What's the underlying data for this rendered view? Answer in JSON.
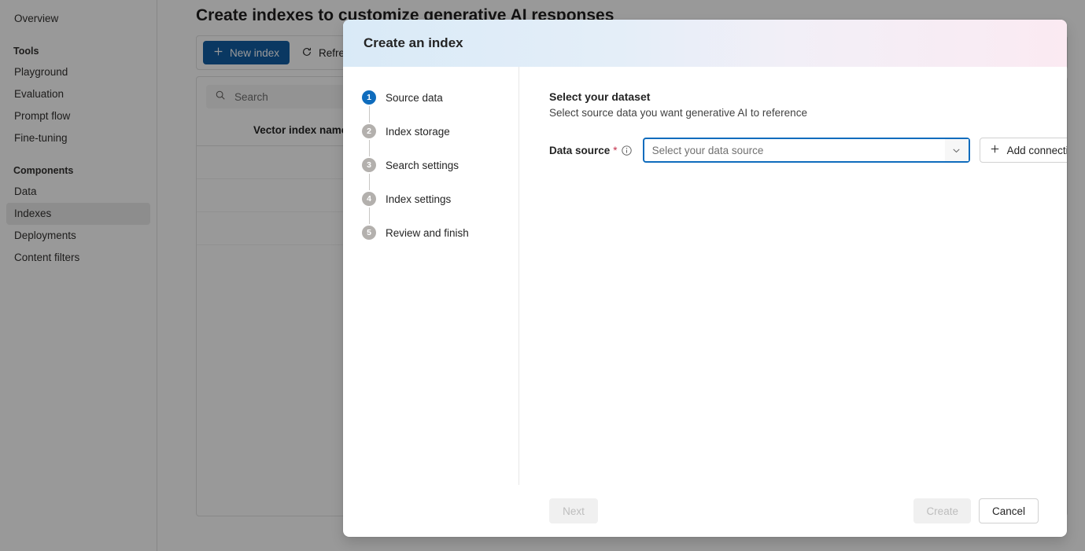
{
  "background": {
    "sidebar": {
      "top_items": [
        {
          "label": "Overview",
          "icon": "overview-icon",
          "selected": false
        }
      ],
      "groups": [
        {
          "title": "Tools",
          "items": [
            {
              "label": "Playground",
              "selected": false
            },
            {
              "label": "Evaluation",
              "selected": false
            },
            {
              "label": "Prompt flow",
              "selected": false
            },
            {
              "label": "Fine-tuning",
              "selected": false
            }
          ]
        },
        {
          "title": "Components",
          "items": [
            {
              "label": "Data",
              "selected": false
            },
            {
              "label": "Indexes",
              "selected": true
            },
            {
              "label": "Deployments",
              "selected": false
            },
            {
              "label": "Content filters",
              "selected": false
            }
          ]
        }
      ]
    },
    "page_title": "Create indexes to customize generative AI responses",
    "command_bar": {
      "new_index_label": "New index",
      "new_index_icon": "plus-icon",
      "refresh_label": "Refresh",
      "refresh_icon": "refresh-icon"
    },
    "search": {
      "placeholder": "Search",
      "value": "",
      "icon": "search-icon"
    },
    "table": {
      "columns": [
        "Vector index name"
      ],
      "rows": []
    }
  },
  "modal": {
    "title": "Create an index",
    "header_gradient_start": "#d9eaf7",
    "header_gradient_end": "#fbeaf2",
    "accent_color": "#0f6cbd",
    "steps": [
      {
        "num": "1",
        "label": "Source data",
        "active": true
      },
      {
        "num": "2",
        "label": "Index storage",
        "active": false
      },
      {
        "num": "3",
        "label": "Search settings",
        "active": false
      },
      {
        "num": "4",
        "label": "Index settings",
        "active": false
      },
      {
        "num": "5",
        "label": "Review and finish",
        "active": false
      }
    ],
    "form": {
      "heading": "Select your dataset",
      "subheading": "Select source data you want generative AI to reference",
      "field_label": "Data source",
      "required_marker": "*",
      "info_icon": "info-icon",
      "dropdown": {
        "placeholder": "Select your data source",
        "value": "",
        "caret_icon": "chevron-down-icon"
      },
      "add_connection": {
        "label": "Add connection",
        "icon": "plus-icon"
      }
    },
    "footer": {
      "next_label": "Next",
      "next_disabled": true,
      "create_label": "Create",
      "create_disabled": true,
      "cancel_label": "Cancel"
    }
  }
}
